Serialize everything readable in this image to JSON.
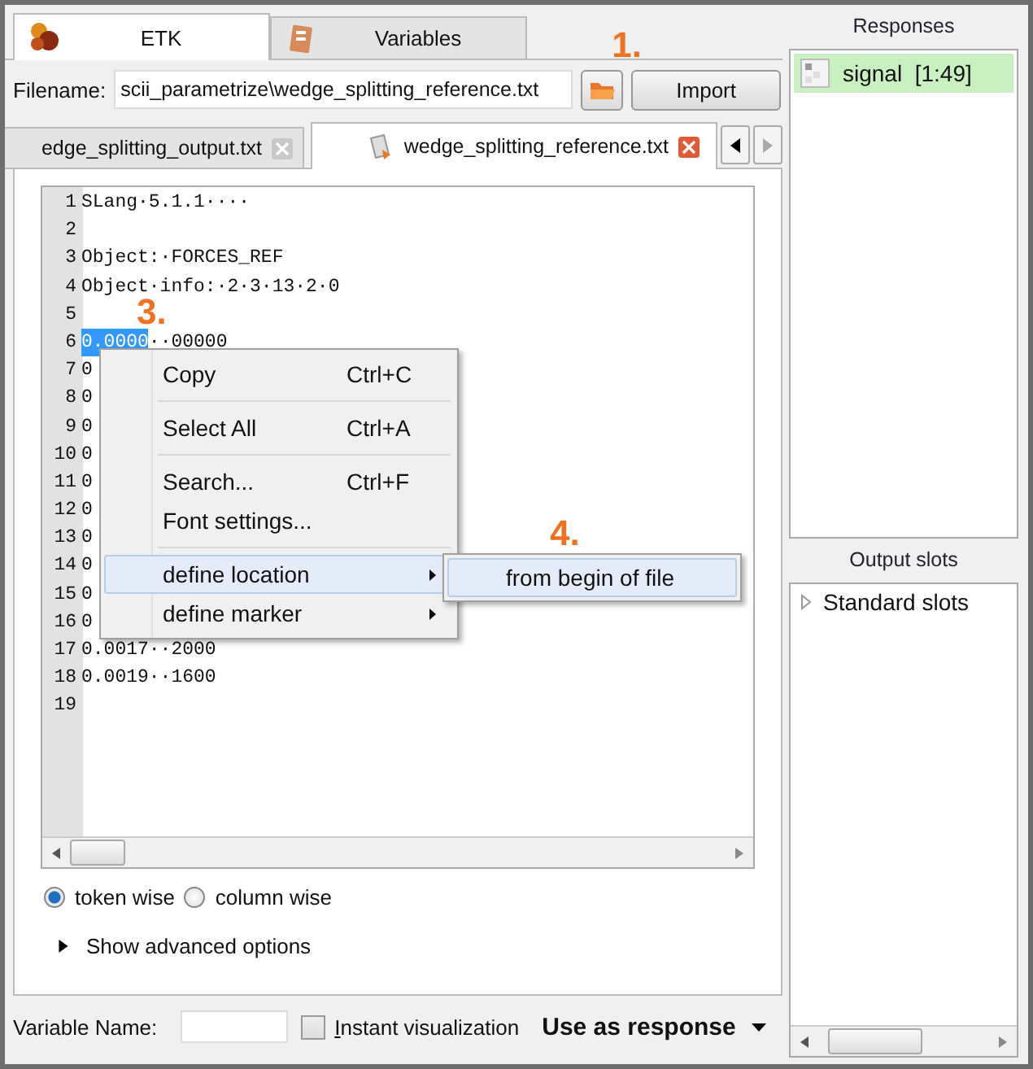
{
  "main_tabs": [
    {
      "label": "ETK",
      "selected": true
    },
    {
      "label": "Variables",
      "selected": false
    }
  ],
  "filename": {
    "label": "Filename:",
    "value": "scii_parametrize\\wedge_splitting_reference.txt"
  },
  "import_button": "Import",
  "import_callout": "1.",
  "file_tabs": [
    {
      "label": "edge_splitting_output.txt",
      "selected": false
    },
    {
      "label": "wedge_splitting_reference.txt",
      "selected": true
    }
  ],
  "editor": {
    "lines": [
      {
        "number": "1",
        "text": "SLang·5.1.1····"
      },
      {
        "number": "2"
      },
      {
        "number": "3",
        "text": "Object:·FORCES_REF"
      },
      {
        "number": "4",
        "text": "Object·info:·2·3·13·2·0"
      },
      {
        "number": "5"
      },
      {
        "number": "6",
        "selected_text": "0.0000",
        "text": "··00000"
      },
      {
        "number": "7",
        "text": "0"
      },
      {
        "number": "8",
        "text": "0"
      },
      {
        "number": "9",
        "text": "0"
      },
      {
        "number": "10",
        "text": "0"
      },
      {
        "number": "11",
        "text": "0"
      },
      {
        "number": "12",
        "text": "0"
      },
      {
        "number": "13",
        "text": "0"
      },
      {
        "number": "14",
        "text": "0"
      },
      {
        "number": "15",
        "text": "0"
      },
      {
        "number": "16",
        "text": "0"
      },
      {
        "number": "17",
        "text": "0.0017··2000"
      },
      {
        "number": "18",
        "text": "0.0019··1600"
      },
      {
        "number": "19"
      }
    ]
  },
  "selection_callout": "3.",
  "context_menu": {
    "groups": [
      [
        {
          "label": "Copy",
          "shortcut": "Ctrl+C",
          "selected": false
        }
      ],
      [
        {
          "label": "Select All",
          "shortcut": "Ctrl+A",
          "selected": false
        }
      ],
      [
        {
          "label": "Search...",
          "shortcut": "Ctrl+F",
          "selected": false
        },
        {
          "label": "Font settings...",
          "selected": false
        }
      ],
      [
        {
          "label": "define location",
          "has_submenu": true,
          "selected": true
        },
        {
          "label": "define marker",
          "has_submenu": true,
          "selected": false
        }
      ]
    ]
  },
  "submenu": {
    "items": [
      {
        "label": "from begin of file",
        "selected": true
      }
    ]
  },
  "submenu_callout": "4.",
  "parse_mode": [
    {
      "label": "token wise",
      "selected": true
    },
    {
      "label": "column wise",
      "selected": false
    }
  ],
  "advanced_options": {
    "label": "Show advanced options",
    "expanded": false
  },
  "variable_name": {
    "label": "Variable Name:"
  },
  "instant_visualization": {
    "label": "Instant visualization",
    "checked": false
  },
  "use_as_response": "Use as response",
  "responses": {
    "title": "Responses",
    "items": [
      {
        "label": "signal  [1:49]",
        "selected": true
      }
    ]
  },
  "output_slots": {
    "title": "Output slots",
    "items": [
      {
        "label": "Standard slots",
        "expanded": false
      }
    ]
  }
}
